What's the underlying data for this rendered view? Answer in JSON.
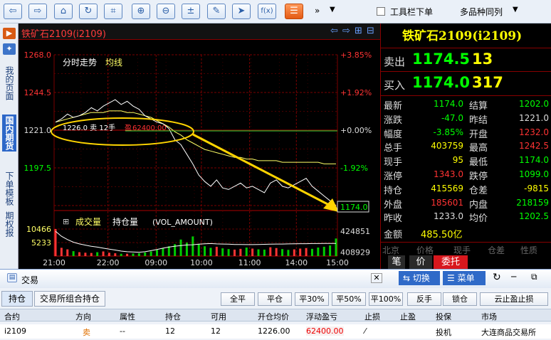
{
  "toolbar": {
    "checkbox_label": "工具栏下单",
    "multi_label": "多品种同列",
    "more": "»",
    "dropdown": "▼",
    "buttons": [
      {
        "name": "back-button",
        "glyph": "⇦"
      },
      {
        "name": "forward-button",
        "glyph": "⇨"
      },
      {
        "name": "home-button",
        "glyph": "⌂"
      },
      {
        "name": "refresh-button",
        "glyph": "↻"
      },
      {
        "name": "crop-button",
        "glyph": "⌗"
      },
      {
        "name": "zoom-in-button",
        "glyph": "⊕"
      },
      {
        "name": "zoom-out-button",
        "glyph": "⊖"
      },
      {
        "name": "formula-button",
        "glyph": "±"
      },
      {
        "name": "draw-button",
        "glyph": "✎"
      },
      {
        "name": "select-button",
        "glyph": "➤"
      },
      {
        "name": "fx-button",
        "glyph": "f(x)"
      },
      {
        "name": "list-button",
        "glyph": "☰"
      }
    ]
  },
  "sidebar": {
    "tabs": [
      {
        "label": "我的页面",
        "active": false
      },
      {
        "label": "国内期货",
        "active": true
      },
      {
        "label": "下单模板",
        "active": false
      },
      {
        "label": "期权报",
        "active": false
      }
    ]
  },
  "chart": {
    "title": "铁矿石2109(i2109)",
    "subtitle_a": "分时走势",
    "subtitle_b": "均线",
    "vol_label": "成交量",
    "oi_label": "持仓量",
    "vol_indicator": "(VOL_AMOUNT)",
    "annotation": "1226.0 卖 12手",
    "annotation_pl_prefix": "盈",
    "annotation_pl": "62400.00",
    "price_label": "1174.0",
    "header_icons": [
      "⇦",
      "⇨",
      "⊞",
      "⊟"
    ]
  },
  "quote": {
    "title": "铁矿石2109(i2109)",
    "sell": {
      "label": "卖出",
      "price": "1174.5",
      "qty": "13"
    },
    "buy": {
      "label": "买入",
      "price": "1174.0",
      "qty": "317"
    },
    "rows": [
      {
        "l1": "最新",
        "v1": "1174.0",
        "c1": "#00ff00",
        "l2": "结算",
        "v2": "1202.0",
        "c2": "#00ff00"
      },
      {
        "l1": "涨跌",
        "v1": "-47.0",
        "c1": "#00ff00",
        "l2": "昨结",
        "v2": "1221.0",
        "c2": "#dddddd"
      },
      {
        "l1": "幅度",
        "v1": "-3.85%",
        "c1": "#00ff00",
        "l2": "开盘",
        "v2": "1232.0",
        "c2": "#ff3333"
      },
      {
        "l1": "总手",
        "v1": "403759",
        "c1": "#ffff00",
        "l2": "最高",
        "v2": "1242.5",
        "c2": "#ff3333"
      },
      {
        "l1": "现手",
        "v1": "95",
        "c1": "#ffff00",
        "l2": "最低",
        "v2": "1174.0",
        "c2": "#00ff00"
      },
      {
        "l1": "涨停",
        "v1": "1343.0",
        "c1": "#ff3333",
        "l2": "跌停",
        "v2": "1099.0",
        "c2": "#00ff00"
      },
      {
        "l1": "持仓",
        "v1": "415569",
        "c1": "#ffff00",
        "l2": "仓差",
        "v2": "-9815",
        "c2": "#ffff00"
      },
      {
        "l1": "外盘",
        "v1": "185601",
        "c1": "#ff3333",
        "l2": "内盘",
        "v2": "218159",
        "c2": "#00ff00"
      },
      {
        "l1": "昨收",
        "v1": "1233.0",
        "c1": "#dddddd",
        "l2": "均价",
        "v2": "1202.5",
        "c2": "#00ff00"
      }
    ],
    "amount_label": "金额",
    "amount_val": "485.50亿",
    "tick_headers": [
      "北京",
      "价格",
      "现手",
      "仓差",
      "性质"
    ],
    "tabs": [
      "笔",
      "价",
      "委托"
    ]
  },
  "trade": {
    "title": "交易",
    "switch_label": "切换",
    "menu_label": "菜单",
    "tabs": [
      "持仓",
      "交易所组合持仓"
    ],
    "buttons": [
      "全平",
      "平仓",
      "平30%",
      "平50%",
      "平100%",
      "反手",
      "锁仓",
      "云止盈止损"
    ],
    "columns": [
      "合约",
      "方向",
      "属性",
      "持仓",
      "可用",
      "开仓均价",
      "浮动盈亏",
      "止损",
      "止盈",
      "投保",
      "市场"
    ],
    "row": [
      "i2109",
      "卖",
      "--",
      "12",
      "12",
      "1226.00",
      "62400.00",
      "⁄",
      "",
      "投机",
      "大连商品交易所"
    ]
  },
  "chart_data": {
    "type": "line",
    "price_axis_left": [
      1268.0,
      1244.5,
      1221.0,
      1197.5,
      1174.0
    ],
    "price_axis_right": [
      "+3.85%",
      "+1.92%",
      "+0.00%",
      "-1.92%",
      "-3.85%"
    ],
    "pre_settle": 1221.0,
    "ylim": [
      1174.0,
      1268.0
    ],
    "time_labels": [
      "21:00",
      "22:00",
      "09:00",
      "10:00",
      "11:00",
      "14:00",
      "15:00"
    ],
    "vol_axis": [
      10466,
      5233
    ],
    "oi_axis": [
      424851,
      408929
    ],
    "price": [
      1226,
      1228,
      1231,
      1229,
      1230,
      1232,
      1235,
      1233,
      1236,
      1238,
      1240,
      1237,
      1239,
      1236,
      1234,
      1230,
      1228,
      1226,
      1225,
      1222,
      1215,
      1212,
      1206,
      1200,
      1193,
      1189,
      1186,
      1190,
      1185,
      1184,
      1186,
      1188,
      1185,
      1186,
      1184,
      1182,
      1188,
      1190,
      1186,
      1185,
      1187,
      1189,
      1191,
      1186,
      1183,
      1180,
      1177,
      1174
    ],
    "avg": [
      1226,
      1227,
      1228,
      1229,
      1230,
      1231,
      1232,
      1232,
      1232,
      1233,
      1233,
      1233,
      1232,
      1232,
      1231,
      1230,
      1229,
      1227,
      1225,
      1223,
      1220,
      1218,
      1215,
      1213,
      1211,
      1209,
      1208,
      1207,
      1206,
      1205,
      1204,
      1204,
      1203,
      1203,
      1202,
      1202,
      1202,
      1202,
      1201,
      1201,
      1201,
      1201,
      1201,
      1201,
      1201,
      1200,
      1200,
      1200
    ],
    "volume": [
      10466,
      3200,
      2600,
      1900,
      1500,
      1300,
      1200,
      1500,
      1800,
      1300,
      1100,
      900,
      900,
      1000,
      1100,
      1400,
      1800,
      2400,
      3100,
      3800,
      4600,
      6400,
      5200,
      7600,
      4700,
      3800,
      3200,
      3600,
      3000,
      2700,
      2500,
      2800,
      3300,
      2900,
      2600,
      2500,
      3400,
      3100,
      2700,
      2400,
      2600,
      2900,
      3100,
      2800,
      3300,
      3600,
      4100,
      6800
    ],
    "open_interest": [
      424851,
      421000,
      418500,
      416500,
      415200,
      414300,
      413400,
      412800,
      412000,
      411300,
      410600,
      409800,
      409300,
      409100,
      408929,
      409300,
      410100,
      411000,
      412000,
      412800,
      413500,
      414000,
      414400,
      414600,
      415000,
      415300,
      415500,
      415200,
      415100,
      415000,
      414800,
      414800,
      414700,
      414700,
      414800,
      414900,
      415000,
      415100,
      415100,
      415200,
      415300,
      415400,
      415400,
      415500,
      415500,
      415600,
      415600,
      415569
    ]
  },
  "colors": {
    "up": "#ff3333",
    "down": "#00ff00",
    "grid": "#8b0000",
    "price_line": "#ffffff",
    "avg_line": "#ffff66",
    "annotation": "#ffd400"
  }
}
